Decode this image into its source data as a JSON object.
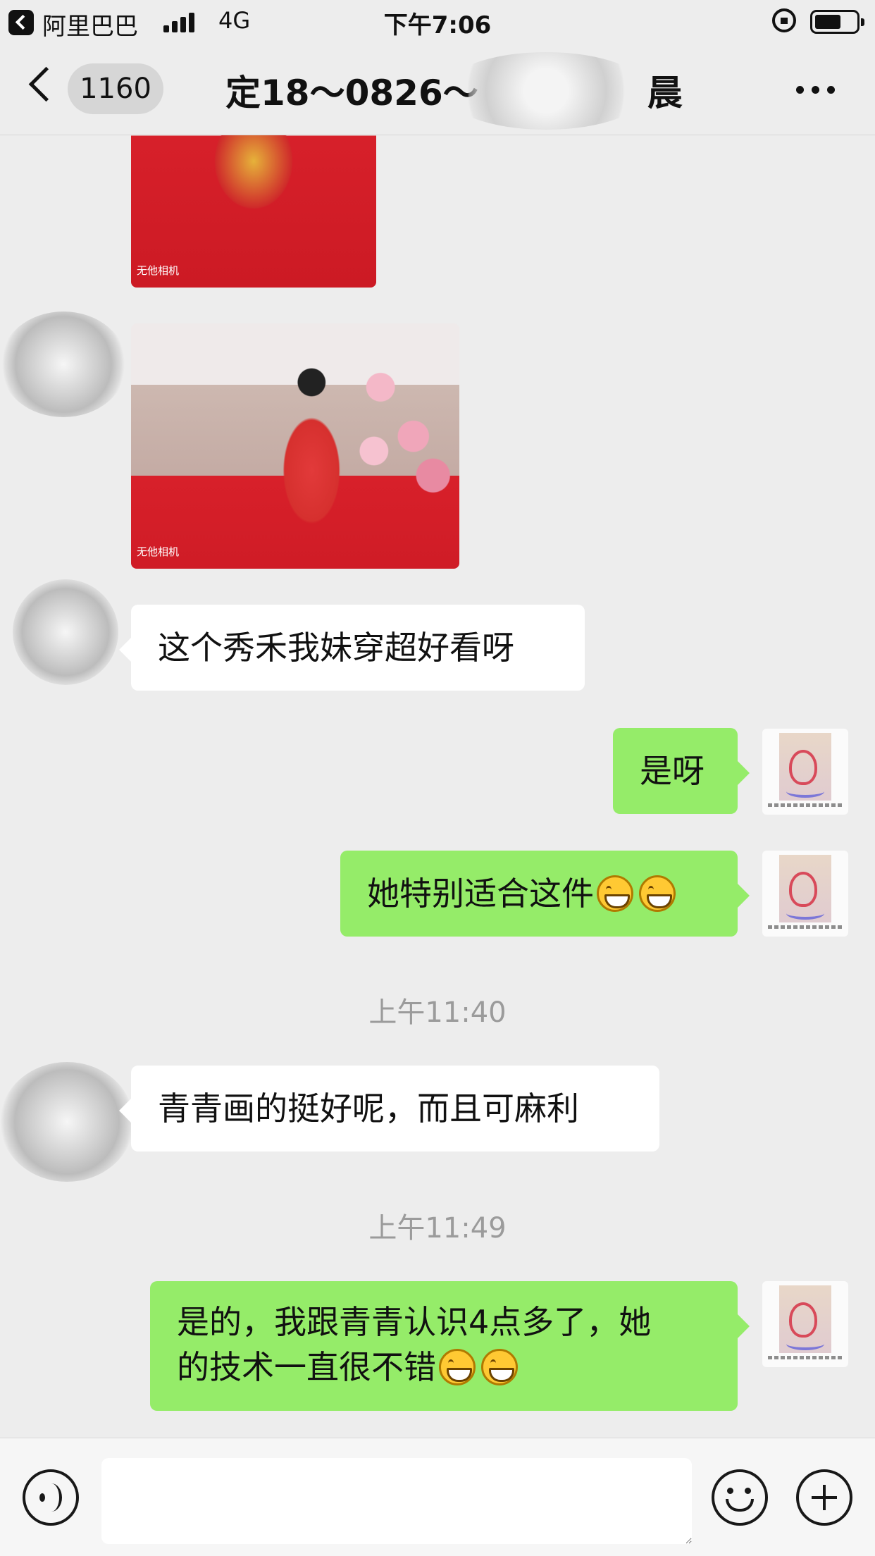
{
  "status_bar": {
    "carrier": "阿里巴巴",
    "network": "4G",
    "time": "下午7:06",
    "battery_level": 0.65
  },
  "nav": {
    "unread_badge": "1160",
    "title": "定18～0826～",
    "title_tail": "晨"
  },
  "messages": [
    {
      "type": "image",
      "side": "incoming",
      "description_icon": "photo-icon",
      "watermark": "无他相机"
    },
    {
      "type": "image",
      "side": "incoming",
      "description_icon": "photo-icon",
      "watermark": "无他相机"
    },
    {
      "type": "text",
      "side": "incoming",
      "text": "这个秀禾我妹穿超好看呀"
    },
    {
      "type": "text",
      "side": "outgoing",
      "text": "是呀"
    },
    {
      "type": "text",
      "side": "outgoing",
      "text": "她特别适合这件",
      "emoji_count": 2
    },
    {
      "type": "timestamp",
      "text": "上午11:40"
    },
    {
      "type": "text",
      "side": "incoming",
      "text": "青青画的挺好呢，而且可麻利"
    },
    {
      "type": "timestamp",
      "text": "上午11:49"
    },
    {
      "type": "text",
      "side": "outgoing",
      "line1": "是的，我跟青青认识4点多了，她",
      "line2": "的技术一直很不错",
      "emoji_count": 2
    }
  ],
  "input_bar": {
    "voice_icon": "voice-icon",
    "emoji_icon": "smiley-icon",
    "plus_icon": "plus-icon",
    "input_value": ""
  },
  "colors": {
    "background": "#ededed",
    "outgoing_bubble": "#95ec69",
    "incoming_bubble": "#ffffff",
    "timestamp_text": "#9b9b9b"
  }
}
